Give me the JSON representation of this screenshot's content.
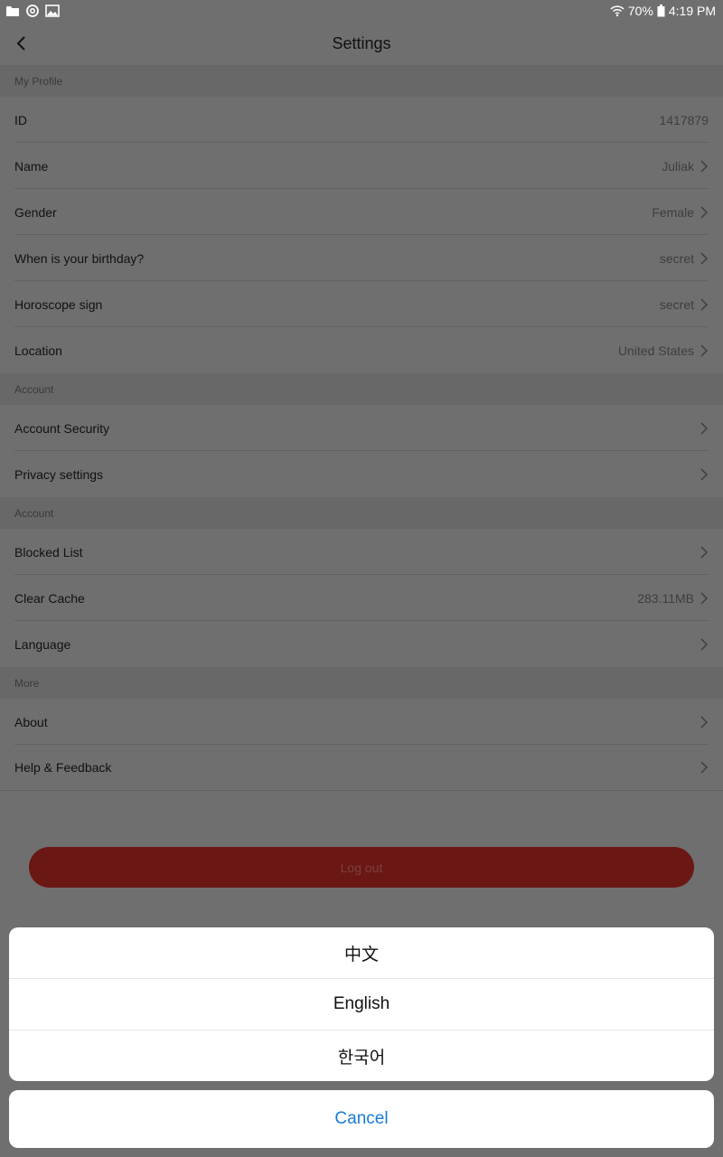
{
  "status_bar": {
    "battery": "70%",
    "time": "4:19 PM",
    "left_icons": [
      "folder-icon",
      "at-sign-icon",
      "image-icon"
    ],
    "right_icons": [
      "wifi-icon",
      "battery-icon"
    ]
  },
  "header": {
    "title": "Settings",
    "back_icon": "chevron-left-icon"
  },
  "sections": {
    "profile": {
      "title": "My Profile",
      "rows": [
        {
          "label": "ID",
          "value": "1417879"
        },
        {
          "label": "Name",
          "value": "Juliak"
        },
        {
          "label": "Gender",
          "value": "Female"
        },
        {
          "label": "When is your birthday?",
          "value": "secret"
        },
        {
          "label": "Horoscope sign",
          "value": "secret"
        },
        {
          "label": "Location",
          "value": "United States"
        }
      ]
    },
    "account": {
      "title": "Account",
      "rows": [
        {
          "label": "Account Security"
        },
        {
          "label": "Privacy settings"
        }
      ]
    },
    "account2": {
      "title": "Account",
      "rows": [
        {
          "label": "Blocked List"
        },
        {
          "label": "Clear Cache",
          "value": "283.11MB"
        },
        {
          "label": "Language"
        }
      ]
    },
    "more": {
      "title": "More",
      "rows": [
        {
          "label": "About"
        },
        {
          "label": "Help & Feedback"
        }
      ]
    }
  },
  "logout_label": "Log out",
  "language_sheet": {
    "options": [
      "中文",
      "English",
      "한국어"
    ],
    "cancel": "Cancel"
  },
  "colors": {
    "overlay_bg": "#6f6f6f",
    "logout_bg": "#6b1714",
    "cancel_text": "#1a7bd3"
  }
}
